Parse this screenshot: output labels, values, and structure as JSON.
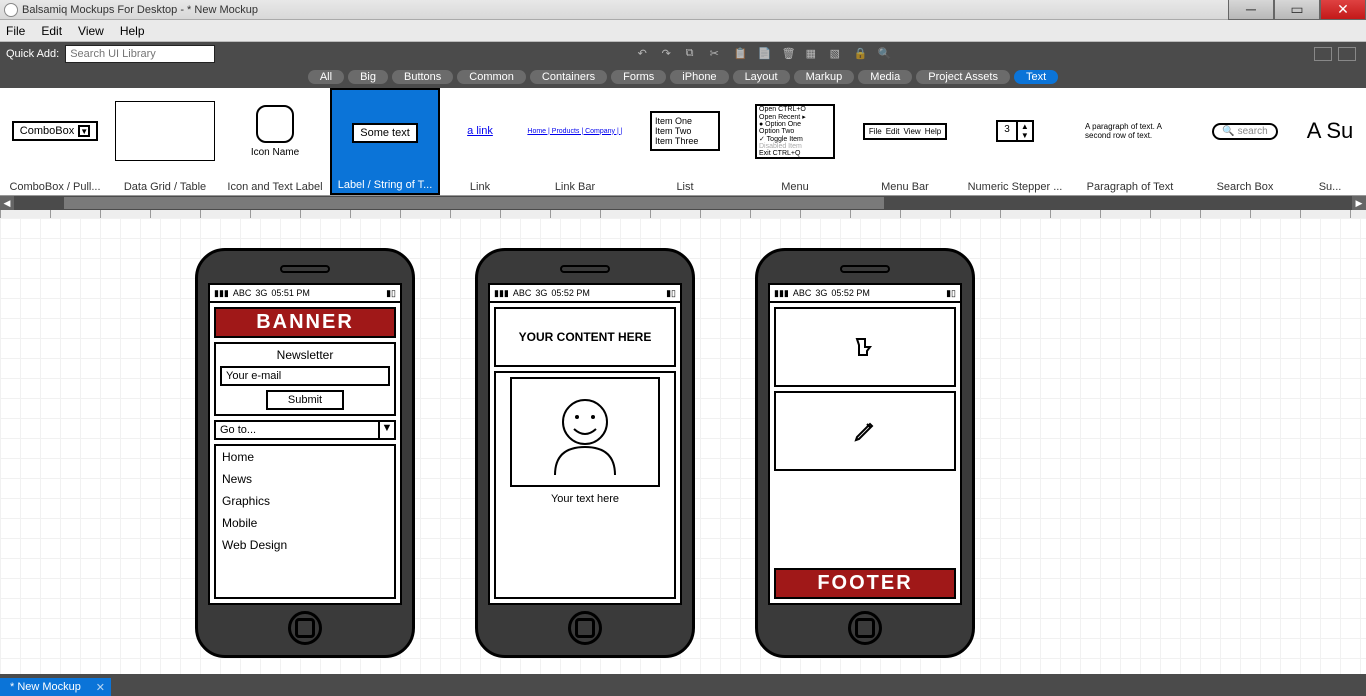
{
  "title": "Balsamiq Mockups For Desktop - * New Mockup",
  "menubar": [
    "File",
    "Edit",
    "View",
    "Help"
  ],
  "quickadd": {
    "label": "Quick Add:",
    "placeholder": "Search UI Library"
  },
  "categories": [
    "All",
    "Big",
    "Buttons",
    "Common",
    "Containers",
    "Forms",
    "iPhone",
    "Layout",
    "Markup",
    "Media",
    "Project Assets",
    "Text"
  ],
  "activeCategory": "Text",
  "library": [
    {
      "label": "ComboBox / Pull...",
      "thumbText": "ComboBox"
    },
    {
      "label": "Data Grid / Table"
    },
    {
      "label": "Icon and Text Label",
      "thumbText": "Icon Name"
    },
    {
      "label": "Label / String of T...",
      "thumbText": "Some text",
      "selected": true
    },
    {
      "label": "Link",
      "thumbText": "a link"
    },
    {
      "label": "Link Bar",
      "thumbText": "Home | Products | Company | |"
    },
    {
      "label": "List",
      "items": [
        "Item One",
        "Item Two",
        "Item Three"
      ]
    },
    {
      "label": "Menu",
      "items": [
        "Open        CTRL+O",
        "Open Recent       ▸",
        "● Option One",
        "  Option Two",
        "✓ Toggle Item",
        "  Disabled Item",
        "Exit        CTRL+Q"
      ]
    },
    {
      "label": "Menu Bar",
      "items": [
        "File",
        "Edit",
        "View",
        "Help"
      ]
    },
    {
      "label": "Numeric Stepper ...",
      "thumbText": "3"
    },
    {
      "label": "Paragraph of Text",
      "thumbText": "A paragraph of text.\nA second row of text."
    },
    {
      "label": "Search Box",
      "thumbText": "search"
    },
    {
      "label": "Su...",
      "thumbText": "A Su"
    }
  ],
  "phones": {
    "p1": {
      "status": {
        "carrier": "ABC",
        "net": "3G",
        "time": "05:51 PM"
      },
      "banner": "BANNER",
      "newsletter": {
        "title": "Newsletter",
        "placeholder": "Your e-mail",
        "submit": "Submit"
      },
      "goto": "Go to...",
      "nav": [
        "Home",
        "News",
        "Graphics",
        "Mobile",
        "Web Design"
      ]
    },
    "p2": {
      "status": {
        "carrier": "ABC",
        "net": "3G",
        "time": "05:52 PM"
      },
      "heading": "YOUR CONTENT HERE",
      "caption": "Your text here"
    },
    "p3": {
      "status": {
        "carrier": "ABC",
        "net": "3G",
        "time": "05:52 PM"
      },
      "footer": "FOOTER"
    }
  },
  "tab": "* New Mockup"
}
